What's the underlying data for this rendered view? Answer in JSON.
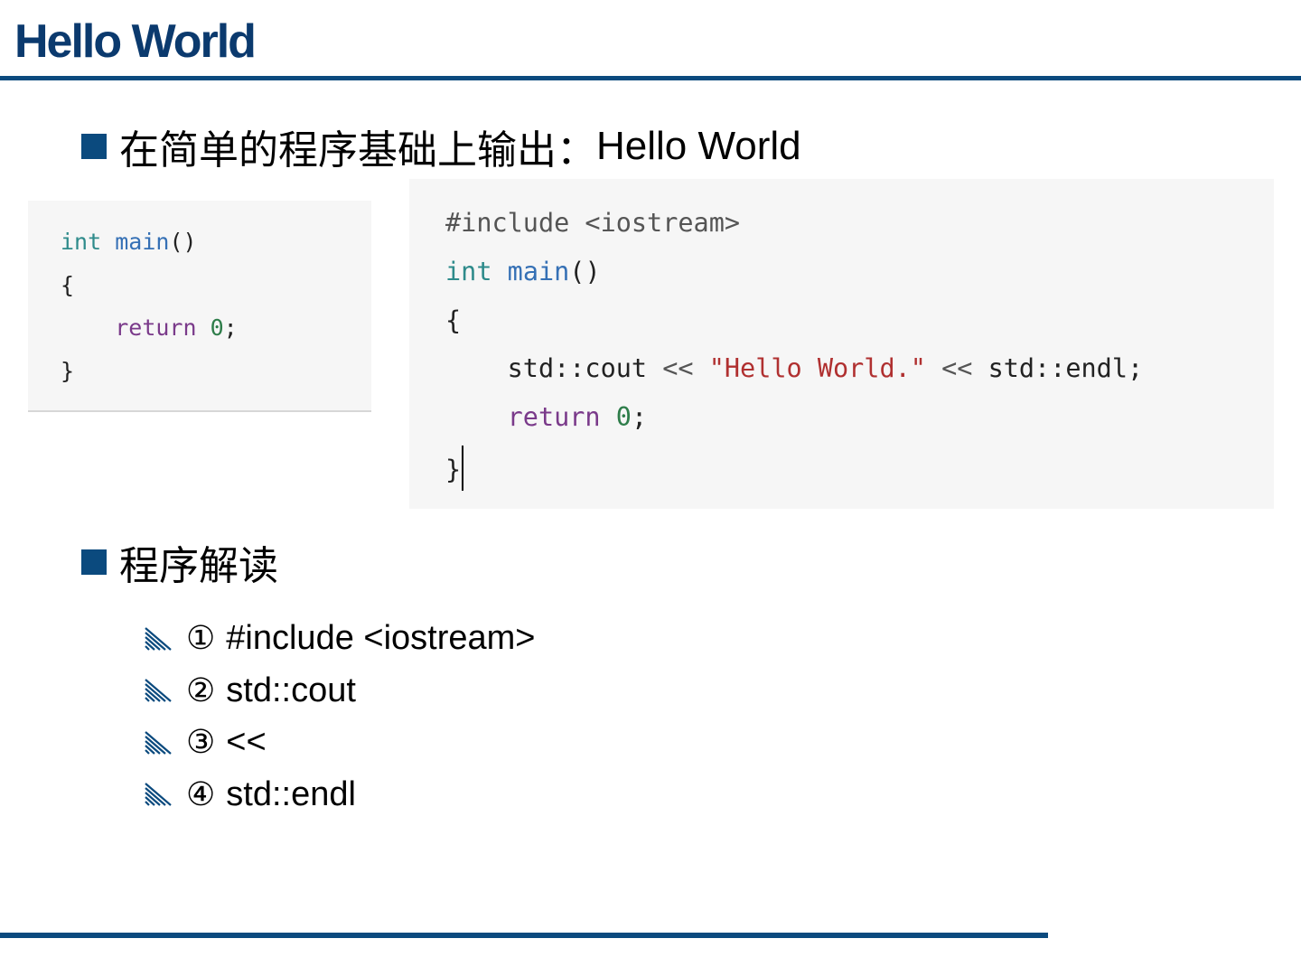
{
  "slide": {
    "title": "Hello World",
    "bullets": [
      {
        "text_cn": "在简单的程序基础上输出：",
        "text_en": "Hello World"
      },
      {
        "text_cn": "程序解读",
        "text_en": ""
      }
    ],
    "explanations": [
      {
        "num": "①",
        "text": "#include <iostream>"
      },
      {
        "num": "②",
        "text": "std::cout"
      },
      {
        "num": "③",
        "text": "<<"
      },
      {
        "num": "④",
        "text": "std::endl"
      }
    ]
  },
  "code_small": {
    "l1": {
      "kw": "int",
      "fn": "main",
      "rest": "()"
    },
    "l2": "{",
    "l3": {
      "indent": "    ",
      "ctl": "return",
      "num": "0",
      "end": ";"
    },
    "l4": "}"
  },
  "code_large": {
    "l1": "#include <iostream>",
    "l2": {
      "kw": "int",
      "fn": "main",
      "rest": "()"
    },
    "l3": "{",
    "l4": {
      "indent": "    ",
      "id1": "std::cout",
      "op1": " << ",
      "str": "\"Hello World.\"",
      "op2": " << ",
      "id2": "std::endl",
      "end": ";"
    },
    "l5": {
      "indent": "    ",
      "ctl": "return",
      "num": "0",
      "end": ";"
    },
    "l6": "}"
  },
  "colors": {
    "accent": "#0b4a7e",
    "title": "#0b3a6e",
    "code_bg": "#f6f6f6"
  },
  "icons": {
    "bullet_l1": "filled-square-icon",
    "bullet_l2": "diagonal-hatch-icon"
  }
}
